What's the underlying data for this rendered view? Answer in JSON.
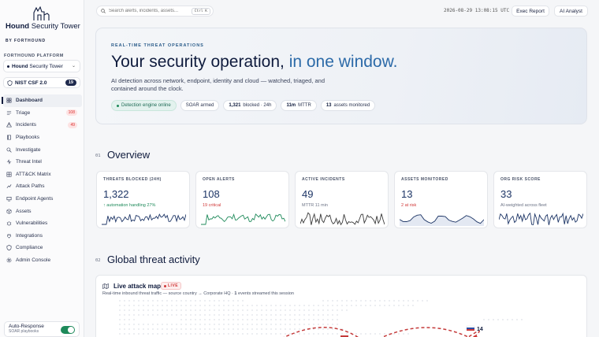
{
  "brand": {
    "name_bold": "Hound",
    "name_rest": " Security Tower",
    "sub": "BY FORTHOUND"
  },
  "sidebar": {
    "platform_label": "FORTHOUND PLATFORM",
    "workspace_bold": "Hound",
    "workspace_rest": " Security Tower",
    "framework": "NIST CSF 2.0",
    "framework_badge": "19",
    "items": [
      {
        "label": "Dashboard",
        "icon": "grid-icon",
        "active": true
      },
      {
        "label": "Triage",
        "icon": "triage-icon",
        "badge": "108"
      },
      {
        "label": "Incidents",
        "icon": "alert-icon",
        "badge": "49"
      },
      {
        "label": "Playbooks",
        "icon": "book-icon"
      },
      {
        "label": "Investigate",
        "icon": "search-icon"
      },
      {
        "label": "Threat Intel",
        "icon": "signal-icon"
      },
      {
        "label": "ATT&CK Matrix",
        "icon": "matrix-icon"
      },
      {
        "label": "Attack Paths",
        "icon": "path-icon"
      },
      {
        "label": "Endpoint Agents",
        "icon": "endpoint-icon"
      },
      {
        "label": "Assets",
        "icon": "box-icon"
      },
      {
        "label": "Vulnerabilities",
        "icon": "bug-icon"
      },
      {
        "label": "Integrations",
        "icon": "plug-icon"
      },
      {
        "label": "Compliance",
        "icon": "shield-icon"
      },
      {
        "label": "Admin Console",
        "icon": "gear-icon"
      }
    ],
    "auto_response": {
      "title": "Auto-Response",
      "sub": "SOAR playbooks",
      "enabled": true
    }
  },
  "topbar": {
    "search_placeholder": "Search alerts, incidents, assets...",
    "shortcut": "Ctrl K",
    "clock": "2026-08-29 13:08:15 UTC",
    "exec_report": "Exec Report",
    "ai_analyst": "AI Analyst"
  },
  "hero": {
    "eyebrow": "REAL-TIME THREAT OPERATIONS",
    "title_main": "Your security operation,",
    "title_accent": " in one window.",
    "description": "AI detection across network, endpoint, identity and cloud — watched, triaged, and contained around the clock.",
    "chips": {
      "engine": "Detection engine online",
      "soar": "SOAR armed",
      "blocked_num": "1,321",
      "blocked_label": " blocked · 24h",
      "mttr_num": "11m",
      "mttr_label": " MTTR",
      "assets_num": "13",
      "assets_label": " assets monitored"
    }
  },
  "overview": {
    "num": "01",
    "title": "Overview",
    "kpis": [
      {
        "label": "THREATS BLOCKED (24H)",
        "value": "1,322",
        "sub": "↑ automation handling 27%",
        "sub_tone": "green",
        "spark_color": "#1d3566"
      },
      {
        "label": "OPEN ALERTS",
        "value": "108",
        "sub": "19 critical",
        "sub_tone": "red",
        "spark_color": "#1e8a5a"
      },
      {
        "label": "ACTIVE INCIDENTS",
        "value": "49",
        "sub": "MTTR 11 min",
        "sub_tone": "muted",
        "spark_color": "#3a3a3a"
      },
      {
        "label": "ASSETS MONITORED",
        "value": "13",
        "sub": "2 at risk",
        "sub_tone": "red",
        "spark_color": "#1d3566"
      },
      {
        "label": "ORG RISK SCORE",
        "value": "33",
        "sub": "AI-weighted across fleet",
        "sub_tone": "muted",
        "spark_color": "#1d3566"
      }
    ]
  },
  "global": {
    "num": "02",
    "title": "Global threat activity",
    "map_title": "Live attack map",
    "live_label": "LIVE",
    "subtitle_prefix": "Real-time inbound threat traffic — source country → Corporate HQ · ",
    "events_count": "1",
    "subtitle_suffix": " events streamed this session",
    "country_count": "14"
  },
  "colors": {
    "accent": "#2c6aa8",
    "navy": "#0f1b3d",
    "success": "#1e8a5a",
    "danger": "#d03838"
  }
}
